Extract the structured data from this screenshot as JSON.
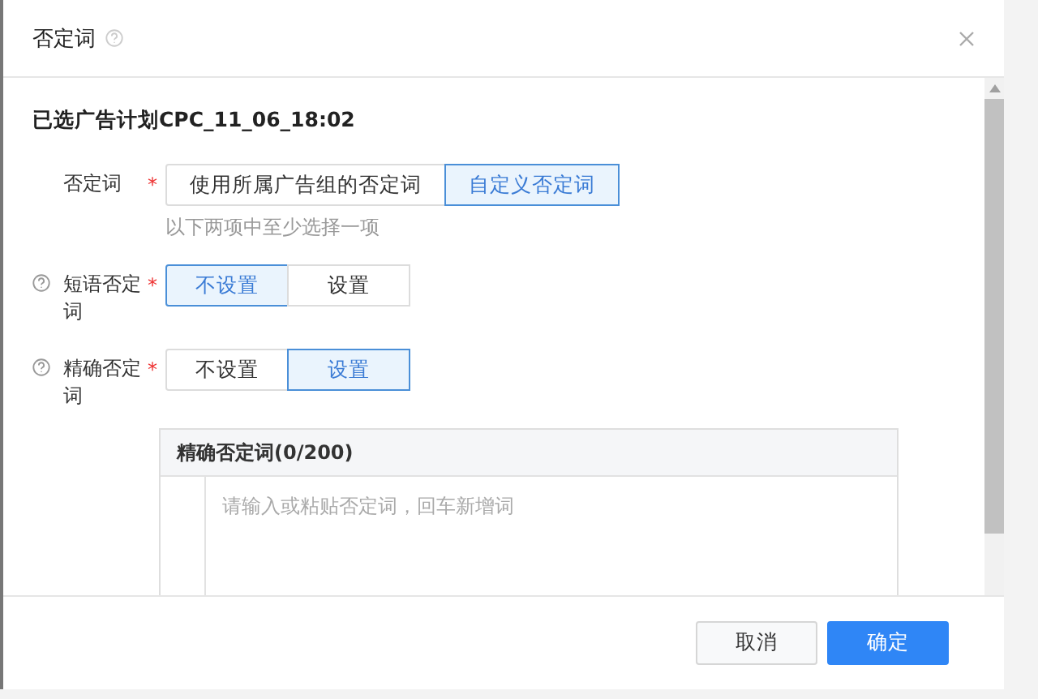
{
  "dialog": {
    "title": "否定词",
    "help": true
  },
  "plan_title": "已选广告计划CPC_11_06_18:02",
  "fields": [
    {
      "label": "否定词",
      "required_mark": "*",
      "help": false,
      "options": [
        {
          "label": "使用所属广告组的否定词",
          "selected": false
        },
        {
          "label": "自定义否定词",
          "selected": true
        }
      ],
      "hint": "以下两项中至少选择一项"
    },
    {
      "label": "短语否定词",
      "required_mark": "*",
      "help": true,
      "options": [
        {
          "label": "不设置",
          "selected": true
        },
        {
          "label": "设置",
          "selected": false
        }
      ]
    },
    {
      "label": "精确否定词",
      "required_mark": "*",
      "help": true,
      "options": [
        {
          "label": "不设置",
          "selected": false
        },
        {
          "label": "设置",
          "selected": true
        }
      ]
    }
  ],
  "exact_list": {
    "header": "精确否定词(0/200)",
    "placeholder": "请输入或粘贴否定词，回车新增词"
  },
  "buttons": [
    {
      "label": "取消",
      "kind": "secondary"
    },
    {
      "label": "确定",
      "kind": "primary"
    }
  ]
}
